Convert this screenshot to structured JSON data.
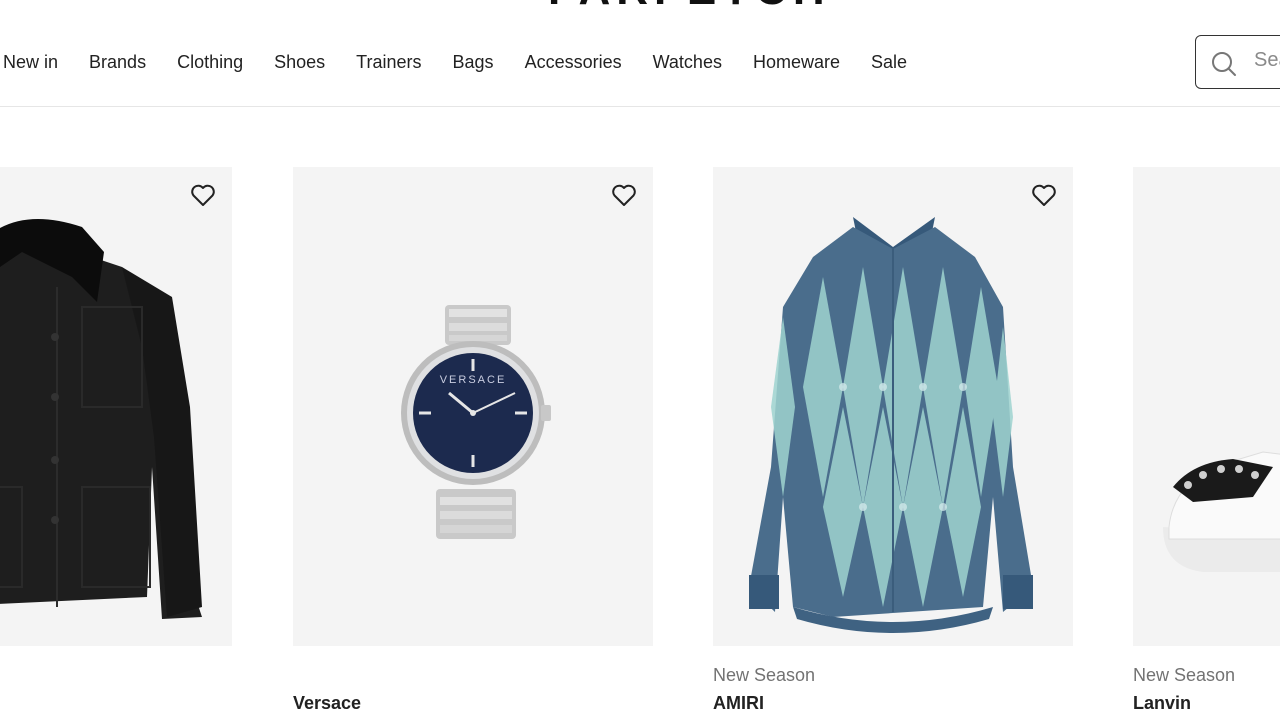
{
  "header": {
    "logo": "FARFETCH",
    "nav": [
      "New in",
      "Brands",
      "Clothing",
      "Shoes",
      "Trainers",
      "Bags",
      "Accessories",
      "Watches",
      "Homeware",
      "Sale"
    ],
    "search_placeholder": "Search"
  },
  "products": [
    {
      "image": "black-jacket",
      "season": "",
      "brand": ""
    },
    {
      "image": "versace-watch",
      "season": "",
      "brand": "Versace",
      "dial_text": "VERSACE"
    },
    {
      "image": "amiri-silk-shirt",
      "season": "New Season",
      "brand": "AMIRI"
    },
    {
      "image": "lanvin-sneaker",
      "season": "New Season",
      "brand": "Lanvin"
    }
  ],
  "colors": {
    "image_bg": "#f4f4f4",
    "muted_text": "#727272",
    "watch_dial": "#1c2a4e",
    "shirt_blue": "#4a6d8c",
    "shirt_aqua": "#9fd4d0"
  }
}
